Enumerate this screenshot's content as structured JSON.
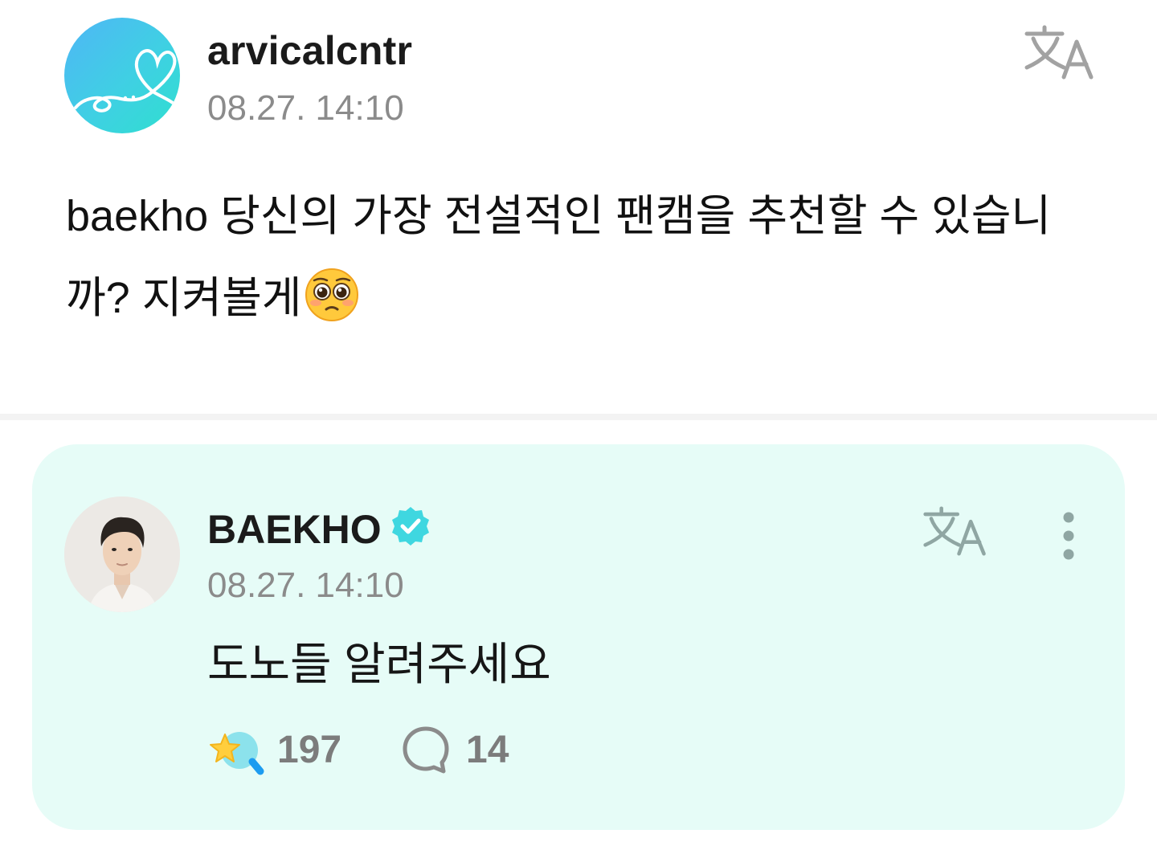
{
  "post": {
    "username": "arvicalcntr",
    "timestamp": "08.27. 14:10",
    "text": "baekho 당신의 가장 전설적인 팬캠을 추천할 수 있습니까? 지켜볼게",
    "emoji": "pleading-face",
    "translate_icon": "translate-icon"
  },
  "comment": {
    "artist_name": "BAEKHO",
    "verified_icon": "verified-badge-icon",
    "timestamp": "08.27. 14:10",
    "text": "도노들 알려주세요",
    "like_count": "197",
    "reply_count": "14",
    "translate_icon": "translate-icon",
    "more_icon": "more-vertical-icon"
  },
  "colors": {
    "comment_background": "#e6fcf7",
    "verified": "#3fd7e0",
    "secondary_text": "#8b8b8b",
    "icon_gray": "#a2a2a2",
    "icon_comment": "#8fa6a3"
  }
}
